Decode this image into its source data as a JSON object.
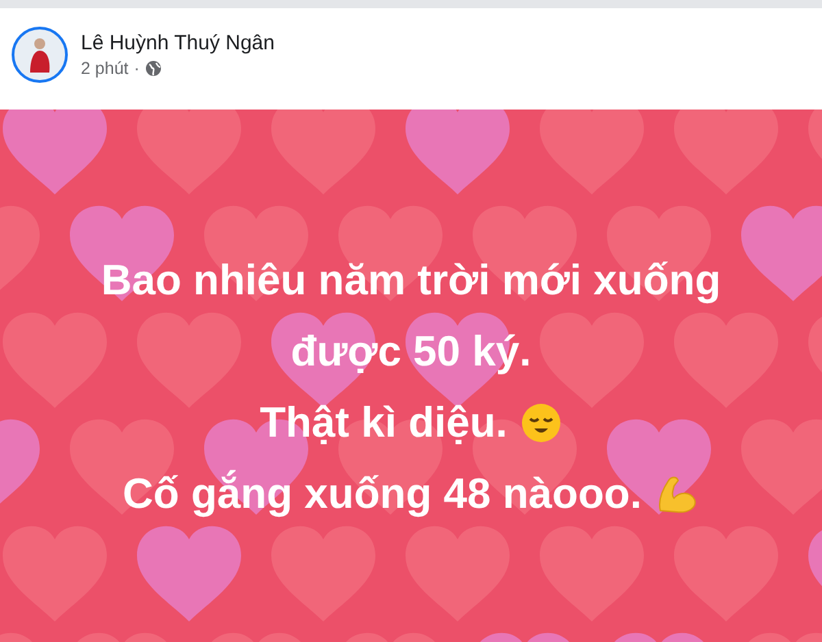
{
  "post": {
    "author": "Lê Huỳnh Thuý Ngân",
    "time": "2 phút",
    "separator": "·",
    "text_lines": [
      "Bao nhiêu năm trời mới xuống",
      "được 50 ký.",
      "Thật kì diệu.",
      "Cố gắng xuống 48 nàooo."
    ]
  }
}
